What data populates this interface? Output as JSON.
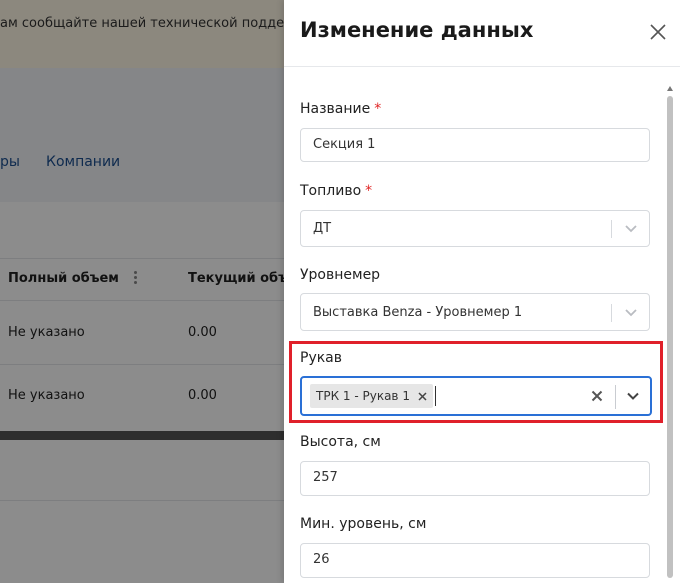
{
  "background": {
    "notice_text": "ам сообщайте нашей технической поддерж",
    "tabs": [
      "ры",
      "Компании"
    ],
    "table": {
      "columns": [
        "Полный объем",
        "Текущий объем"
      ],
      "rows": [
        [
          "Не указано",
          "0.00"
        ],
        [
          "Не указано",
          "0.00"
        ]
      ]
    }
  },
  "drawer": {
    "title": "Изменение данных",
    "required_mark": "*",
    "fields": {
      "name": {
        "label": "Название",
        "value": "Секция 1"
      },
      "fuel": {
        "label": "Топливо",
        "value": "ДТ"
      },
      "level_gauge": {
        "label": "Уровнемер",
        "value": "Выставка Benza - Уровнемер 1"
      },
      "hose": {
        "label": "Рукав",
        "selected": [
          "ТРК 1 - Рукав 1"
        ]
      },
      "height": {
        "label": "Высота, см",
        "value": "257"
      },
      "min_level": {
        "label": "Мин. уровень, см",
        "value": "26"
      }
    }
  },
  "colors": {
    "accent": "#2a70d6",
    "required": "#e02424",
    "highlight": "#e0202a",
    "link": "#1d4f91"
  }
}
